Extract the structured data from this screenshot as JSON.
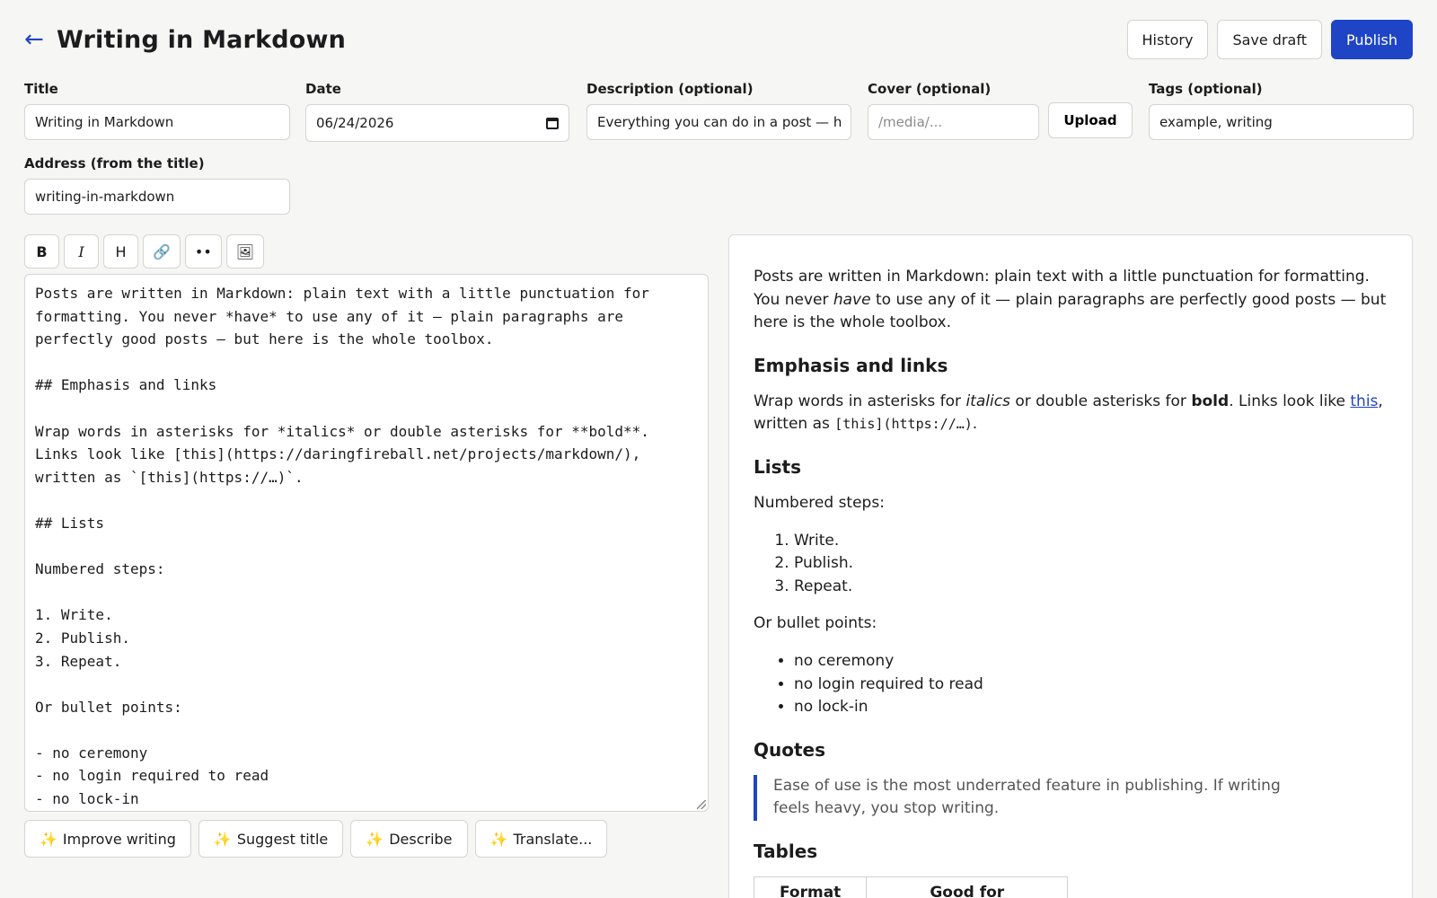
{
  "header": {
    "title": "Writing in Markdown",
    "back_icon": "←",
    "history_label": "History",
    "save_draft_label": "Save draft",
    "publish_label": "Publish"
  },
  "fields": {
    "title_label": "Title",
    "title_value": "Writing in Markdown",
    "date_label": "Date",
    "date_value": "06/24/2026",
    "description_label": "Description (optional)",
    "description_value": "Everything you can do in a post — h",
    "cover_label": "Cover (optional)",
    "cover_placeholder": "/media/...",
    "upload_label": "Upload",
    "tags_label": "Tags (optional)",
    "tags_value": "example, writing",
    "address_label": "Address (from the title)",
    "address_value": "writing-in-markdown"
  },
  "toolbar": {
    "bold": "B",
    "italic": "I",
    "heading": "H",
    "link": "🔗",
    "list": "••",
    "image": "🖼"
  },
  "editor": {
    "content": "Posts are written in Markdown: plain text with a little punctuation for\nformatting. You never *have* to use any of it — plain paragraphs are\nperfectly good posts — but here is the whole toolbox.\n\n## Emphasis and links\n\nWrap words in asterisks for *italics* or double asterisks for **bold**.\nLinks look like [this](https://daringfireball.net/projects/markdown/),\nwritten as `[this](https://…)`.\n\n## Lists\n\nNumbered steps:\n\n1. Write.\n2. Publish.\n3. Repeat.\n\nOr bullet points:\n\n- no ceremony\n- no login required to read\n- no lock-in"
  },
  "ai_actions": {
    "improve": "Improve writing",
    "suggest_title": "Suggest title",
    "describe": "Describe",
    "translate": "Translate...",
    "icon": "✨"
  },
  "preview": {
    "p1_a": "Posts are written in Markdown: plain text with a little punctuation for formatting. You never ",
    "p1_em": "have",
    "p1_b": " to use any of it — plain paragraphs are perfectly good posts — but here is the whole toolbox.",
    "h_emphasis": "Emphasis and links",
    "p2_a": "Wrap words in asterisks for ",
    "p2_em": "italics",
    "p2_b": " or double asterisks for ",
    "p2_strong": "bold",
    "p2_c": ". Links look like ",
    "p2_link": "this",
    "p2_d": ", written as ",
    "p2_code": "[this](https://…)",
    "p2_e": ".",
    "h_lists": "Lists",
    "p_numbered": "Numbered steps:",
    "ol": [
      "Write.",
      "Publish.",
      "Repeat."
    ],
    "p_bullets": "Or bullet points:",
    "ul": [
      "no ceremony",
      "no login required to read",
      "no lock-in"
    ],
    "h_quotes": "Quotes",
    "quote": "Ease of use is the most underrated feature in publishing. If writing feels heavy, you stop writing.",
    "h_tables": "Tables",
    "table_headers": [
      "Format",
      "Good for"
    ]
  }
}
